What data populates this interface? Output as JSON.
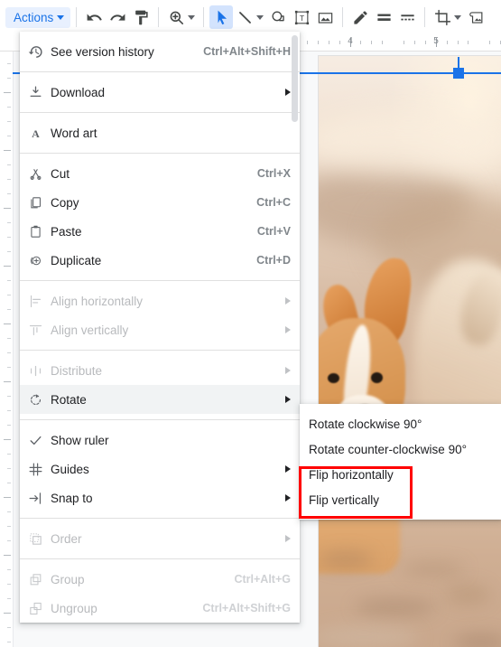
{
  "toolbar": {
    "actions_label": "Actions",
    "buttons": [
      {
        "name": "undo-icon",
        "title": "Undo"
      },
      {
        "name": "redo-icon",
        "title": "Redo"
      },
      {
        "name": "paint-format-icon",
        "title": "Paint format"
      },
      {
        "name": "zoom-icon",
        "title": "Zoom"
      },
      {
        "name": "select-cursor-icon",
        "title": "Select"
      },
      {
        "name": "line-icon",
        "title": "Line"
      },
      {
        "name": "shape-icon",
        "title": "Shape"
      },
      {
        "name": "text-box-icon",
        "title": "Text box"
      },
      {
        "name": "insert-image-icon",
        "title": "Image"
      },
      {
        "name": "pen-icon",
        "title": "Line color"
      },
      {
        "name": "line-weight-icon",
        "title": "Line weight"
      },
      {
        "name": "line-dash-icon",
        "title": "Line dash"
      },
      {
        "name": "crop-icon",
        "title": "Crop image"
      },
      {
        "name": "image-options-icon",
        "title": "Image options"
      }
    ]
  },
  "menu": {
    "items": [
      {
        "label": "See version history",
        "shortcut": "Ctrl+Alt+Shift+H",
        "icon": "history-icon",
        "arrow": false,
        "disabled": false,
        "highlight": false,
        "sep_after": true
      },
      {
        "label": "Download",
        "shortcut": "",
        "icon": "download-icon",
        "arrow": true,
        "disabled": false,
        "highlight": false,
        "sep_after": true
      },
      {
        "label": "Word art",
        "shortcut": "",
        "icon": "word-art-icon",
        "arrow": false,
        "disabled": false,
        "highlight": false,
        "sep_after": true
      },
      {
        "label": "Cut",
        "shortcut": "Ctrl+X",
        "icon": "cut-icon",
        "arrow": false,
        "disabled": false,
        "highlight": false,
        "sep_after": false
      },
      {
        "label": "Copy",
        "shortcut": "Ctrl+C",
        "icon": "copy-icon",
        "arrow": false,
        "disabled": false,
        "highlight": false,
        "sep_after": false
      },
      {
        "label": "Paste",
        "shortcut": "Ctrl+V",
        "icon": "paste-icon",
        "arrow": false,
        "disabled": false,
        "highlight": false,
        "sep_after": false
      },
      {
        "label": "Duplicate",
        "shortcut": "Ctrl+D",
        "icon": "duplicate-icon",
        "arrow": false,
        "disabled": false,
        "highlight": false,
        "sep_after": true
      },
      {
        "label": "Align horizontally",
        "shortcut": "",
        "icon": "align-horizontal-icon",
        "arrow": true,
        "disabled": true,
        "highlight": false,
        "sep_after": false
      },
      {
        "label": "Align vertically",
        "shortcut": "",
        "icon": "align-vertical-icon",
        "arrow": true,
        "disabled": true,
        "highlight": false,
        "sep_after": true
      },
      {
        "label": "Distribute",
        "shortcut": "",
        "icon": "distribute-icon",
        "arrow": true,
        "disabled": true,
        "highlight": false,
        "sep_after": false
      },
      {
        "label": "Rotate",
        "shortcut": "",
        "icon": "rotate-icon",
        "arrow": true,
        "disabled": false,
        "highlight": true,
        "sep_after": true
      },
      {
        "label": "Show ruler",
        "shortcut": "",
        "icon": "checkmark-icon",
        "arrow": false,
        "disabled": false,
        "highlight": false,
        "sep_after": false
      },
      {
        "label": "Guides",
        "shortcut": "",
        "icon": "guides-icon",
        "arrow": true,
        "disabled": false,
        "highlight": false,
        "sep_after": false
      },
      {
        "label": "Snap to",
        "shortcut": "",
        "icon": "snap-to-icon",
        "arrow": true,
        "disabled": false,
        "highlight": false,
        "sep_after": true
      },
      {
        "label": "Order",
        "shortcut": "",
        "icon": "order-icon",
        "arrow": true,
        "disabled": true,
        "highlight": false,
        "sep_after": true
      },
      {
        "label": "Group",
        "shortcut": "Ctrl+Alt+G",
        "icon": "group-icon",
        "arrow": false,
        "disabled": true,
        "highlight": false,
        "sep_after": false
      },
      {
        "label": "Ungroup",
        "shortcut": "Ctrl+Alt+Shift+G",
        "icon": "ungroup-icon",
        "arrow": false,
        "disabled": true,
        "highlight": false,
        "sep_after": false
      }
    ]
  },
  "submenu": {
    "items": [
      {
        "label": "Rotate clockwise 90°"
      },
      {
        "label": "Rotate counter-clockwise 90°"
      },
      {
        "label": "Flip horizontally"
      },
      {
        "label": "Flip vertically"
      }
    ]
  },
  "ruler": {
    "labels": [
      "4",
      "5"
    ],
    "label_positions": [
      388,
      483
    ]
  },
  "colors": {
    "accent": "#1a73e8",
    "accent_bg": "#e8f0fe",
    "highlight_bg": "#f1f3f4",
    "disabled_text": "#b8babd",
    "shortcut_text": "#80868b",
    "annotation_red": "#ff0000",
    "menu_bg": "#ffffff",
    "canvas_bg": "#f8f9fa"
  }
}
